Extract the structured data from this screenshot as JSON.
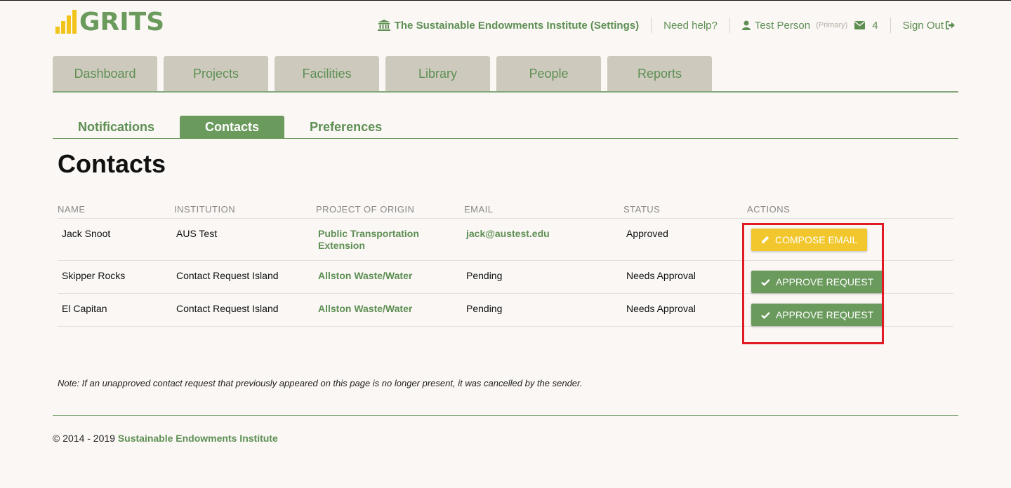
{
  "logo": {
    "text": "GRITS",
    "bar_color": "#f2c419",
    "text_color": "#6a9a5c"
  },
  "header": {
    "institution": "The Sustainable Endowments Institute (Settings)",
    "institution_icon": "institution-icon",
    "help": "Need help?",
    "user_name": "Test Person",
    "user_role": "(Primary)",
    "user_icon": "user-icon",
    "messages_icon": "envelope-icon",
    "messages_count": "4",
    "sign_out": "Sign Out",
    "sign_out_icon": "sign-out-icon"
  },
  "main_tabs": [
    "Dashboard",
    "Projects",
    "Facilities",
    "Library",
    "People",
    "Reports"
  ],
  "sub_tabs": {
    "items": [
      "Notifications",
      "Contacts",
      "Preferences"
    ],
    "active": "Contacts"
  },
  "page_title": "Contacts",
  "table": {
    "headers": [
      "NAME",
      "INSTITUTION",
      "PROJECT OF ORIGIN",
      "EMAIL",
      "STATUS",
      "ACTIONS"
    ],
    "rows": [
      {
        "name": "Jack Snoot",
        "institution": "AUS Test",
        "project": "Public Transportation Extension",
        "email": "jack@austest.edu",
        "status": "Approved",
        "action": "COMPOSE EMAIL",
        "action_icon": "pencil-icon"
      },
      {
        "name": "Skipper Rocks",
        "institution": "Contact Request Island",
        "project": "Allston Waste/Water",
        "email": "Pending",
        "status": "Needs Approval",
        "action": "APPROVE REQUEST",
        "action_icon": "check-icon"
      },
      {
        "name": "El Capitan",
        "institution": "Contact Request Island",
        "project": "Allston Waste/Water",
        "email": "Pending",
        "status": "Needs Approval",
        "action": "APPROVE REQUEST",
        "action_icon": "check-icon"
      }
    ]
  },
  "note": "Note: If an unapproved contact request that previously appeared on this page is no longer present, it was cancelled by the sender.",
  "footer": {
    "copyright": "© 2014 - 2019",
    "org": "Sustainable Endowments Institute"
  },
  "colors": {
    "accent": "#6a9a5c",
    "tab_bg": "#cdcabd",
    "compose": "#f2c72d",
    "highlight": "#e01b24"
  }
}
